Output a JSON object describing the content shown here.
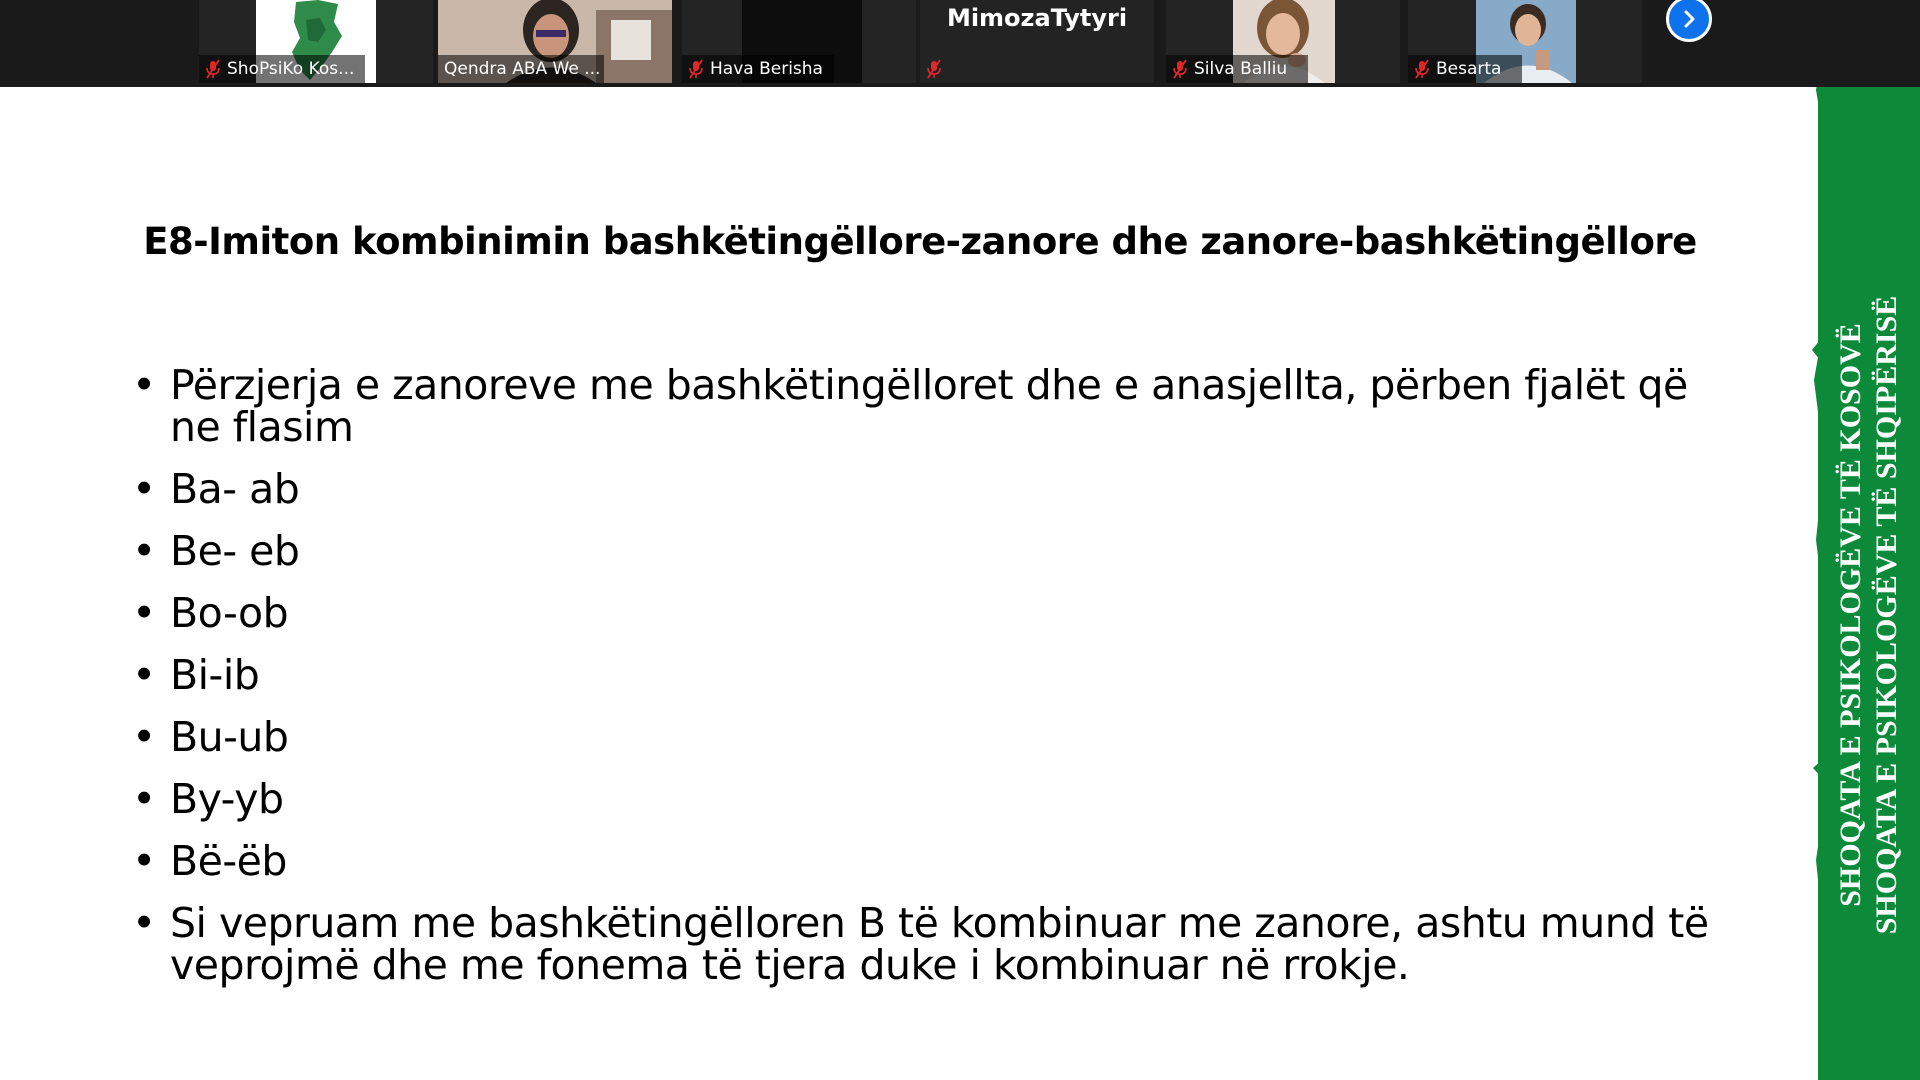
{
  "participants": [
    {
      "name": "ShoPsiKo Kos...",
      "muted": true
    },
    {
      "name": "Qendra ABA We ...",
      "muted": false
    },
    {
      "name": "Hava Berisha",
      "muted": true
    },
    {
      "name": "",
      "big_name": "MimozaTytyri",
      "muted": true
    },
    {
      "name": "Silva Balliu",
      "muted": true
    },
    {
      "name": "Besarta",
      "muted": true
    }
  ],
  "slide": {
    "title": "E8-Imiton kombinimin bashkëtingëllore-zanore  dhe zanore-bashkëtingëllore",
    "bullets": [
      "Përzjerja e zanoreve me bashkëtingëlloret dhe e anasjellta, përben fjalët që ne flasim",
      "Ba- ab",
      "Be- eb",
      "Bo-ob",
      "Bi-ib",
      "Bu-ub",
      "By-yb",
      "Bë-ëb",
      "Si vepruam me bashkëtingëlloren B të kombinuar me zanore, ashtu mund të veprojmë dhe me fonema të tjera duke i kombinuar në rrokje."
    ]
  },
  "banner": {
    "line1": "SHOQATA E PSIKOLOGËVE TË KOSOVË",
    "line2": "SHOQATA E PSIKOLOGËVE TË SHQIPËRISË"
  },
  "colors": {
    "banner_green": "#0c8a3a",
    "next_button": "#0e72ed",
    "muted_mic": "#e02828",
    "strip_bg": "#1a1a1a"
  },
  "icons": {
    "muted": "microphone-muted-icon",
    "next": "chevron-right-icon"
  }
}
